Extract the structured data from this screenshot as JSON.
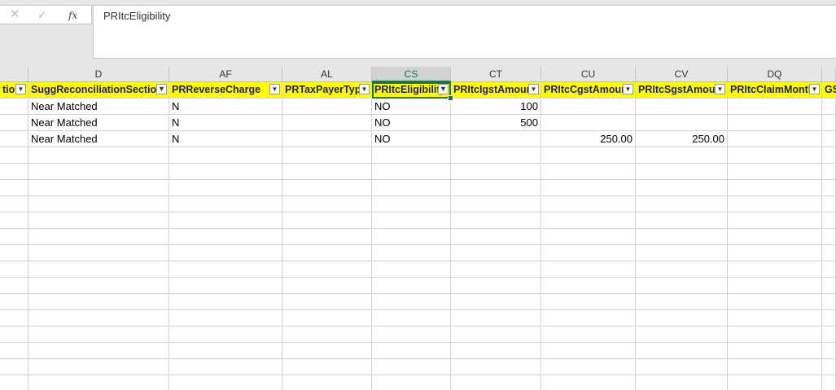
{
  "formula_bar": {
    "cancel_icon": "✕",
    "enter_icon": "✓",
    "fx_label": "fx",
    "content": "PRItcEligibility"
  },
  "columns": [
    {
      "letter": "",
      "header": "tio",
      "selected": false,
      "filtered": false
    },
    {
      "letter": "D",
      "header": "SuggReconciliationSection",
      "selected": false,
      "filtered": true
    },
    {
      "letter": "AF",
      "header": "PRReverseCharge",
      "selected": false,
      "filtered": false
    },
    {
      "letter": "AL",
      "header": "PRTaxPayerType",
      "selected": false,
      "filtered": false
    },
    {
      "letter": "CS",
      "header": "PRItcEligibility",
      "selected": true,
      "filtered": true
    },
    {
      "letter": "CT",
      "header": "PRItcIgstAmount",
      "selected": false,
      "filtered": false
    },
    {
      "letter": "CU",
      "header": "PRItcCgstAmount",
      "selected": false,
      "filtered": false
    },
    {
      "letter": "CV",
      "header": "PRItcSgstAmount",
      "selected": false,
      "filtered": false
    },
    {
      "letter": "DQ",
      "header": "PRItcClaimMonth",
      "selected": false,
      "filtered": false
    },
    {
      "letter": "",
      "header": "GS",
      "selected": false,
      "filtered": false
    }
  ],
  "rows": [
    [
      "",
      "Near Matched",
      "N",
      "",
      "NO",
      "100",
      "",
      "",
      "",
      ""
    ],
    [
      "",
      "Near Matched",
      "N",
      "",
      "NO",
      "500",
      "",
      "",
      "",
      ""
    ],
    [
      "",
      "Near Matched",
      "N",
      "",
      "NO",
      "",
      "250.00",
      "250.00",
      "",
      ""
    ]
  ],
  "colors": {
    "header_fill": "#ffff00",
    "accent": "#217346"
  }
}
